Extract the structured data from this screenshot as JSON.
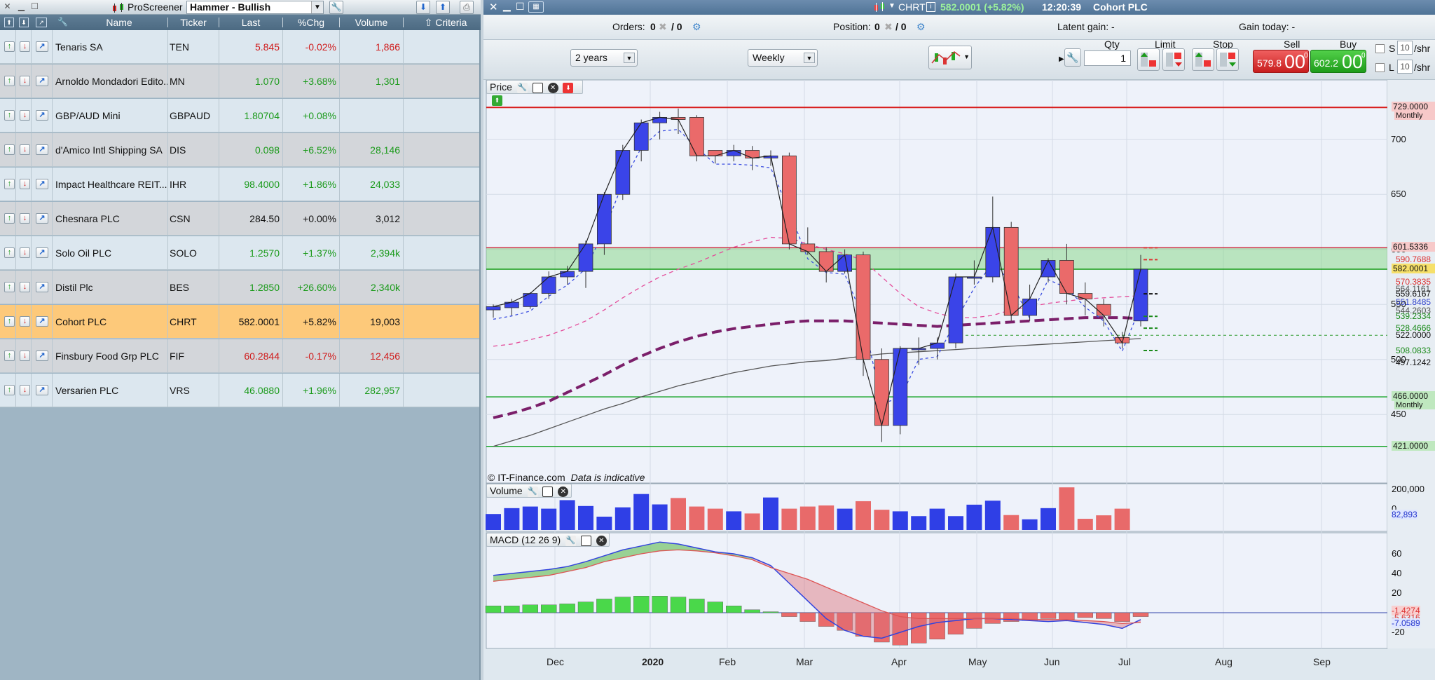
{
  "left": {
    "title": "ProScreener",
    "screener_selected": "Hammer - Bullish",
    "columns": {
      "name": "Name",
      "ticker": "Ticker",
      "last": "Last",
      "chg": "%Chg",
      "volume": "Volume",
      "criteria": "Criteria"
    },
    "rows": [
      {
        "name": "Tenaris SA",
        "ticker": "TEN",
        "last": "5.845",
        "chg": "-0.02%",
        "volume": "1,866",
        "dir": "dn"
      },
      {
        "name": "Arnoldo Mondadori Edito...",
        "ticker": "MN",
        "last": "1.070",
        "chg": "+3.68%",
        "volume": "1,301",
        "dir": "up"
      },
      {
        "name": "GBP/AUD Mini",
        "ticker": "GBPAUD",
        "last": "1.80704",
        "chg": "+0.08%",
        "volume": "",
        "dir": "up"
      },
      {
        "name": "d'Amico Intl Shipping SA",
        "ticker": "DIS",
        "last": "0.098",
        "chg": "+6.52%",
        "volume": "28,146",
        "dir": "up"
      },
      {
        "name": "Impact Healthcare REIT...",
        "ticker": "IHR",
        "last": "98.4000",
        "chg": "+1.86%",
        "volume": "24,033",
        "dir": "up"
      },
      {
        "name": "Chesnara PLC",
        "ticker": "CSN",
        "last": "284.50",
        "chg": "+0.00%",
        "volume": "3,012",
        "dir": "neu"
      },
      {
        "name": "Solo Oil PLC",
        "ticker": "SOLO",
        "last": "1.2570",
        "chg": "+1.37%",
        "volume": "2,394k",
        "dir": "up"
      },
      {
        "name": "Distil Plc",
        "ticker": "BES",
        "last": "1.2850",
        "chg": "+26.60%",
        "volume": "2,340k",
        "dir": "up"
      },
      {
        "name": "Cohort PLC",
        "ticker": "CHRT",
        "last": "582.0001",
        "chg": "+5.82%",
        "volume": "19,003",
        "dir": "sel"
      },
      {
        "name": "Finsbury Food Grp PLC",
        "ticker": "FIF",
        "last": "60.2844",
        "chg": "-0.17%",
        "volume": "12,456",
        "dir": "dn"
      },
      {
        "name": "Versarien PLC",
        "ticker": "VRS",
        "last": "46.0880",
        "chg": "+1.96%",
        "volume": "282,957",
        "dir": "up"
      }
    ]
  },
  "right": {
    "symbol": "CHRT",
    "price_change": "582.0001 (+5.82%)",
    "time": "12:20:39",
    "company": "Cohort PLC",
    "orders_label": "Orders:",
    "orders_value": "0",
    "orders_value2": "/ 0",
    "position_label": "Position:",
    "position_value": "0",
    "position_value2": "/ 0",
    "latent_gain": "Latent gain: -",
    "gain_today": "Gain today: -",
    "period": "2 years",
    "interval": "Weekly",
    "qty_label": "Qty",
    "qty_value": "1",
    "limit_label": "Limit",
    "stop_label": "Stop",
    "sell_label": "Sell",
    "buy_label": "Buy",
    "sell_price_main": "579.8",
    "sell_price_big": "00",
    "sell_price_sup": "0",
    "buy_price_main": "602.2",
    "buy_price_big": "00",
    "buy_price_sup": "0",
    "s_label": "S",
    "l_label": "L",
    "s_val": "10",
    "l_val": "10",
    "per_share": "/shr"
  },
  "chart_data": [
    {
      "type": "candlestick",
      "title": "Price",
      "source": "© IT-Finance.com",
      "note": "Data is indicative",
      "x_ticks": [
        "Dec",
        "2020",
        "Feb",
        "Mar",
        "Apr",
        "May",
        "Jun",
        "Jul",
        "Aug",
        "Sep"
      ],
      "y_ticks": [
        450,
        500,
        550,
        600,
        650,
        700
      ],
      "ylim": [
        410,
        740
      ],
      "candles": [
        [
          545,
          548,
          538,
          550
        ],
        [
          547,
          552,
          540,
          555
        ],
        [
          548,
          560,
          546,
          561
        ],
        [
          560,
          575,
          555,
          580
        ],
        [
          575,
          580,
          568,
          585
        ],
        [
          580,
          605,
          565,
          608
        ],
        [
          605,
          650,
          595,
          652
        ],
        [
          650,
          690,
          645,
          695
        ],
        [
          690,
          715,
          680,
          718
        ],
        [
          715,
          720,
          700,
          725
        ],
        [
          720,
          718,
          705,
          728
        ],
        [
          720,
          685,
          680,
          722
        ],
        [
          690,
          685,
          678,
          690
        ],
        [
          685,
          690,
          680,
          695
        ],
        [
          690,
          683,
          672,
          694
        ],
        [
          683,
          685,
          676,
          690
        ],
        [
          685,
          605,
          600,
          688
        ],
        [
          605,
          598,
          595,
          620
        ],
        [
          598,
          580,
          570,
          602
        ],
        [
          580,
          595,
          578,
          600
        ],
        [
          595,
          500,
          485,
          598
        ],
        [
          500,
          440,
          425,
          510
        ],
        [
          440,
          510,
          432,
          512
        ],
        [
          510,
          510,
          495,
          520
        ],
        [
          510,
          515,
          500,
          520
        ],
        [
          515,
          575,
          510,
          578
        ],
        [
          575,
          575,
          568,
          590
        ],
        [
          575,
          620,
          570,
          648
        ],
        [
          620,
          540,
          535,
          625
        ],
        [
          540,
          555,
          535,
          568
        ],
        [
          575,
          590,
          570,
          592
        ],
        [
          590,
          560,
          550,
          605
        ],
        [
          560,
          555,
          540,
          570
        ],
        [
          550,
          540,
          530,
          555
        ],
        [
          520,
          515,
          510,
          525
        ],
        [
          535,
          582,
          530,
          595
        ]
      ],
      "sma_short_dashed": [
        512,
        514,
        518,
        522,
        528,
        535,
        545,
        556,
        566,
        575,
        582,
        588,
        595,
        602,
        607,
        611,
        610,
        605,
        600,
        596,
        590,
        575,
        560,
        548,
        542,
        538,
        538,
        540,
        545,
        548,
        551,
        553,
        555,
        556,
        557,
        558
      ],
      "sma_long_dashed": [
        447,
        451,
        456,
        462,
        470,
        478,
        486,
        495,
        503,
        510,
        516,
        521,
        525,
        528,
        530,
        532,
        534,
        535,
        535,
        535,
        534,
        533,
        532,
        531,
        530,
        531,
        532,
        533,
        534,
        535,
        536,
        537,
        538,
        538,
        538,
        537
      ],
      "sma_200": [
        421,
        426,
        431,
        437,
        443,
        449,
        455,
        460,
        466,
        471,
        476,
        480,
        484,
        488,
        491,
        494,
        496,
        498,
        499,
        501,
        503,
        505,
        506,
        507,
        508,
        509,
        510,
        511,
        512,
        513,
        514,
        515,
        516,
        517,
        518,
        519
      ],
      "h_lines": [
        {
          "value": 729,
          "label": "729.0000",
          "sub": "Monthly",
          "color": "#d81b1b"
        },
        {
          "value": 601.5336,
          "label": "601.5336",
          "color": "#cc3344"
        },
        {
          "value": 582,
          "label": "582.0001",
          "color": "#119911"
        },
        {
          "value": 466,
          "label": "466.0000",
          "sub": "Monthly",
          "color": "#1aa52a"
        },
        {
          "value": 421,
          "label": "421.0000",
          "color": "#1aa52a"
        }
      ],
      "levels": [
        "590.7688",
        "570.3835",
        "564.1161",
        "559.6167",
        "551.8485",
        "544.2603",
        "539.2334",
        "528.4666",
        "522.0000",
        "508.0833",
        "497.1242"
      ]
    },
    {
      "type": "bar",
      "title": "Volume",
      "y_ticks": [
        "200,000",
        "0"
      ],
      "last_label": "82,893",
      "values": [
        60,
        82,
        88,
        80,
        112,
        90,
        50,
        85,
        135,
        96,
        120,
        88,
        80,
        70,
        62,
        122,
        80,
        88,
        92,
        80,
        108,
        76,
        70,
        52,
        80,
        52,
        95,
        110,
        56,
        40,
        82,
        160,
        42,
        55,
        80
      ]
    },
    {
      "type": "macd",
      "title": "MACD (12 26 9)",
      "y_ticks": [
        60,
        40,
        20,
        "-20"
      ],
      "labels": [
        "-1.4274",
        "-5.6316",
        "-7.0589"
      ],
      "histogram": [
        7,
        7,
        8,
        8,
        9,
        11,
        14,
        16,
        17,
        17,
        16,
        14,
        11,
        7,
        3,
        1,
        -4,
        -9,
        -14,
        -18,
        -24,
        -30,
        -33,
        -31,
        -27,
        -22,
        -16,
        -11,
        -9,
        -8,
        -6,
        -7,
        -5,
        -6,
        -9,
        -4
      ],
      "macd_line": [
        38,
        40,
        42,
        44,
        47,
        52,
        58,
        64,
        68,
        72,
        70,
        66,
        62,
        60,
        56,
        48,
        30,
        12,
        -6,
        -18,
        -24,
        -26,
        -20,
        -14,
        -10,
        -8,
        -6,
        -6,
        -7,
        -8,
        -9,
        -8,
        -10,
        -12,
        -16,
        -7
      ],
      "signal_line": [
        32,
        34,
        36,
        38,
        42,
        46,
        52,
        56,
        60,
        63,
        64,
        63,
        61,
        58,
        54,
        46,
        40,
        34,
        26,
        18,
        10,
        2,
        -4,
        -6,
        -6,
        -6,
        -6,
        -6,
        -6,
        -7,
        -7,
        -7,
        -8,
        -9,
        -11,
        -10
      ]
    }
  ]
}
